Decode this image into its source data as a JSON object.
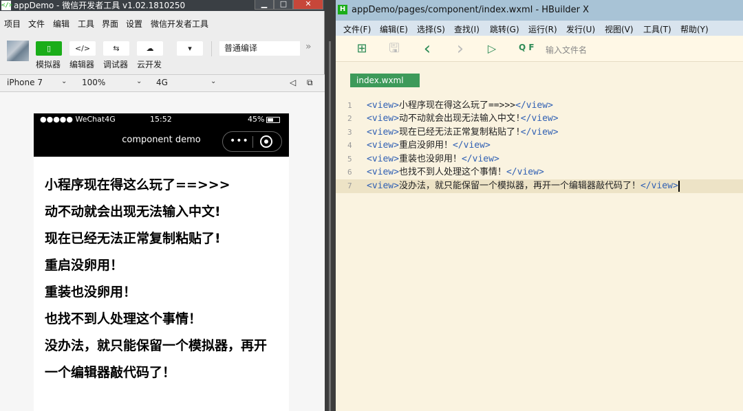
{
  "wechat": {
    "title": "appDemo - 微信开发者工具 v1.02.1810250",
    "app_icon": "</>",
    "window_controls": [
      "▁",
      "□",
      "✕"
    ],
    "menu": [
      "项目",
      "文件",
      "编辑",
      "工具",
      "界面",
      "设置",
      "微信开发者工具"
    ],
    "toolbar": {
      "buttons": [
        {
          "icon": "phone-icon",
          "glyph": "▯",
          "label": "模拟器",
          "active": true
        },
        {
          "icon": "code-icon",
          "glyph": "</>",
          "label": "编辑器",
          "active": false
        },
        {
          "icon": "debug-icon",
          "glyph": "⇆",
          "label": "调试器",
          "active": false
        },
        {
          "icon": "cloud-icon",
          "glyph": "☁",
          "label": "云开发",
          "active": false
        }
      ],
      "dropdown_glyph": "▾",
      "compile_mode": "普通编译",
      "more_glyph": "»"
    },
    "device_bar": {
      "device": "iPhone 7",
      "zoom": "100%",
      "network": "4G",
      "arrow": "⌄",
      "mute_glyph": "◁",
      "popout_glyph": "⧉"
    },
    "phone": {
      "carrier": "●●●●● WeChat4G",
      "time": "15:52",
      "battery": "45%",
      "nav_title": "component demo",
      "capsule_dots": "•••",
      "lines": [
        "小程序现在得这么玩了==>>>",
        "动不动就会出现无法输入中文!",
        "现在已经无法正常复制粘贴了!",
        "重启没卵用！",
        "重装也没卵用！",
        "也找不到人处理这个事情！",
        "没办法，就只能保留一个模拟器，再开",
        "一个编辑器敲代码了！"
      ]
    }
  },
  "hbuilder": {
    "title": "appDemo/pages/component/index.wxml - HBuilder X",
    "icon_letter": "H",
    "menu": [
      "文件(F)",
      "编辑(E)",
      "选择(S)",
      "查找(I)",
      "跳转(G)",
      "运行(R)",
      "发行(U)",
      "视图(V)",
      "工具(T)",
      "帮助(Y)"
    ],
    "toolbar_icons": {
      "new_file": "⊞",
      "save": "🖫",
      "back": "‹",
      "forward": "›",
      "run": "▷",
      "find": "Q F"
    },
    "search_placeholder": "输入文件名",
    "tab": "index.wxml",
    "code": {
      "open_tag": "<view>",
      "close_tag": "</view>",
      "lines": [
        {
          "num": "1",
          "text": "小程序现在得这么玩了==>>>"
        },
        {
          "num": "2",
          "text": "动不动就会出现无法输入中文!"
        },
        {
          "num": "3",
          "text": "现在已经无法正常复制粘贴了!"
        },
        {
          "num": "4",
          "text": "重启没卵用！"
        },
        {
          "num": "5",
          "text": "重装也没卵用！"
        },
        {
          "num": "6",
          "text": "也找不到人处理这个事情！"
        },
        {
          "num": "7",
          "text": "没办法，就只能保留一个模拟器，再开一个编辑器敲代码了！"
        }
      ]
    }
  },
  "colors": {
    "wechat_green": "#1aad19",
    "tag_blue": "#2f5fb3",
    "hb_tab_green": "#3d9a5a"
  }
}
